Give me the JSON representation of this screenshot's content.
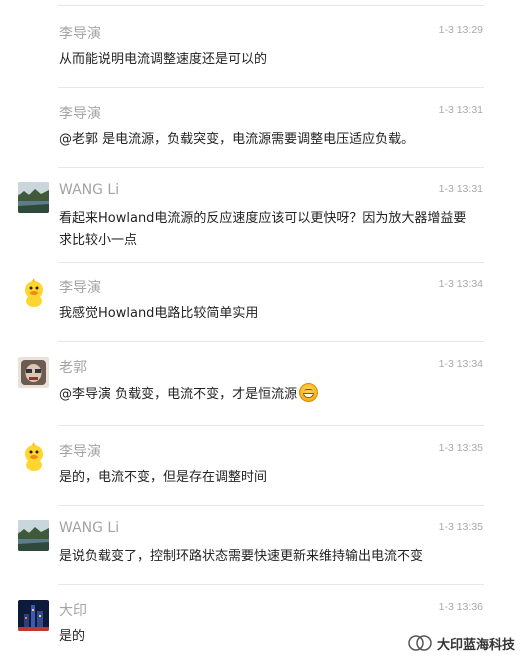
{
  "comments": [
    {
      "name": "李导演",
      "time": "1-3 13:29",
      "text": "从而能说明电流调整速度还是可以的",
      "avatar": "duck-avatar"
    },
    {
      "name": "李导演",
      "time": "1-3 13:31",
      "text": "@老郭 是电流源，负载突变，电流源需要调整电压适应负载。",
      "avatar": "duck-avatar"
    },
    {
      "name": "WANG Li",
      "time": "1-3 13:31",
      "text": "看起来Howland电流源的反应速度应该可以更快呀？因为放大器增益要求比较小一点",
      "avatar": "landscape-avatar"
    },
    {
      "name": "李导演",
      "time": "1-3 13:34",
      "text": "我感觉Howland电路比较简单实用",
      "avatar": "duck-avatar"
    },
    {
      "name": "老郭",
      "time": "1-3 13:34",
      "text": "@李导演 负载变，电流不变，才是恒流源",
      "avatar": "cartoon-avatar",
      "emoji": "grin-emoji"
    },
    {
      "name": "李导演",
      "time": "1-3 13:35",
      "text": "是的，电流不变，但是存在调整时间",
      "avatar": "duck-avatar"
    },
    {
      "name": "WANG Li",
      "time": "1-3 13:35",
      "text": "是说负载变了，控制环路状态需要快速更新来维持输出电流不变",
      "avatar": "landscape-avatar"
    },
    {
      "name": "大印",
      "time": "1-3 13:36",
      "text": "是的",
      "avatar": "city-night-avatar"
    }
  ],
  "watermark": {
    "text": "大印蓝海科技",
    "icon": "wechat-channel-icon"
  }
}
